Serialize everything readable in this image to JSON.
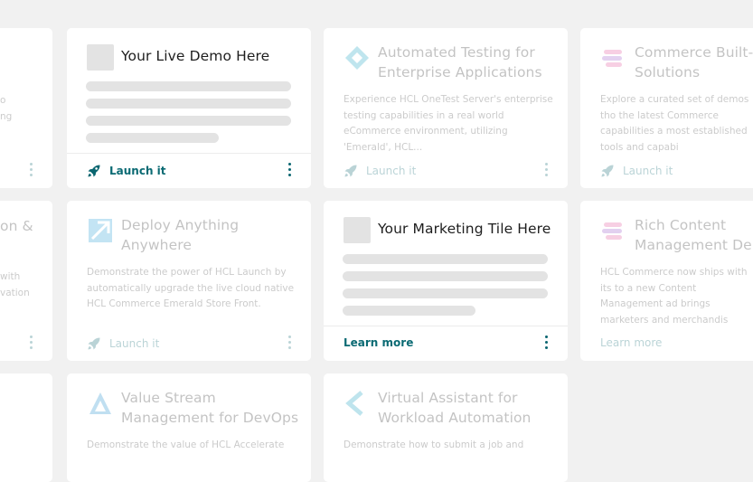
{
  "cards": [
    {
      "title": "",
      "description": "o\nng",
      "action": ""
    },
    {
      "title": "Your Live Demo Here",
      "description": "",
      "action": "Launch it"
    },
    {
      "title": "Automated Testing for Enterprise Applications",
      "description": "Experience HCL OneTest Server's enterprise testing capabilities in a real world eCommerce environment, utilizing 'Emerald', HCL...",
      "action": "Launch it"
    },
    {
      "title": "Commerce Built- Solutions",
      "description": "Explore a curated set of demos tho the latest Commerce capabilities a most established tools and capabi",
      "action": "Launch it"
    },
    {
      "title": "on &",
      "description": "with\nvation",
      "action": ""
    },
    {
      "title": "Deploy Anything Anywhere",
      "description": "Demonstrate the power of HCL Launch by automatically upgrade the live cloud native HCL Commerce Emerald Store Front.",
      "action": "Launch it"
    },
    {
      "title": "Your Marketing Tile Here",
      "description": "",
      "action": "Learn more"
    },
    {
      "title": "Rich Content Management Der",
      "description": "HCL Commerce now ships with its to a new Content Management ad brings marketers and merchandis",
      "action": "Learn more"
    },
    {
      "title": "Value Stream Management for DevOps",
      "description": "Demonstrate the value of HCL Accelerate",
      "action": ""
    },
    {
      "title": "Virtual Assistant for Workload Automation",
      "description": "Demonstrate how to submit a job and",
      "action": ""
    }
  ],
  "icons": {
    "rocket": "rocket-icon",
    "kebab": "more-vertical-icon"
  },
  "colors": {
    "accent": "#0a6670",
    "background": "#f1f1f1",
    "placeholder": "#e3e3e3"
  }
}
